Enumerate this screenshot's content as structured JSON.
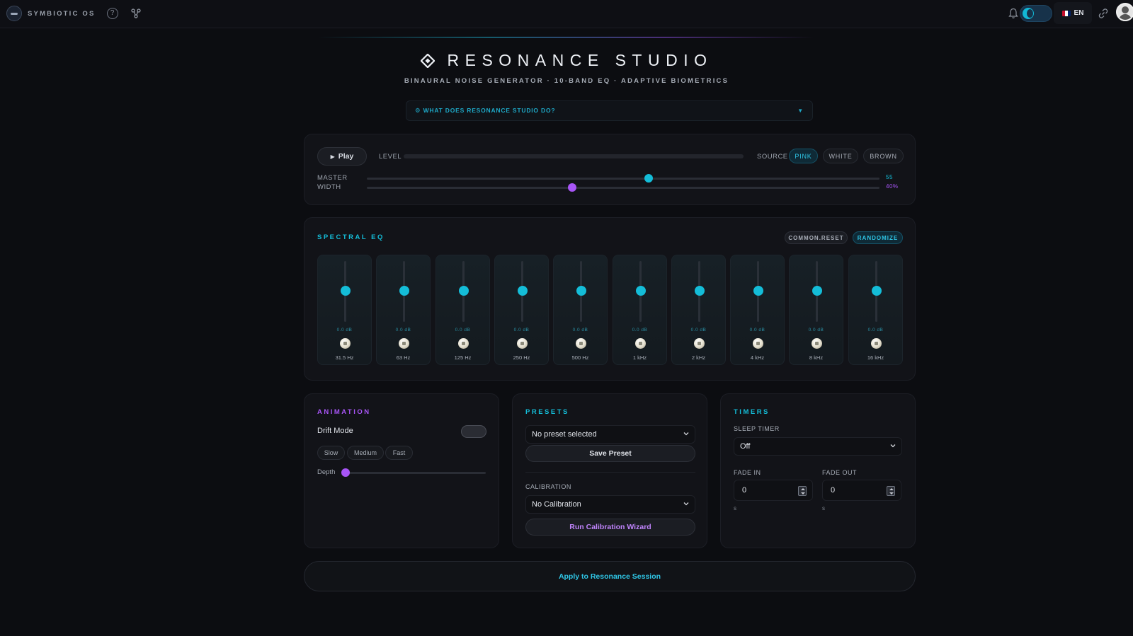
{
  "topbar": {
    "brand_name": "SYMBIOTIC OS",
    "help_label": "?",
    "language": "EN"
  },
  "header": {
    "title": "RESONANCE STUDIO",
    "subtitle": "BINAURAL NOISE GENERATOR · 10-BAND EQ · ADAPTIVE BIOMETRICS",
    "info_bar": "⚙ WHAT DOES RESONANCE STUDIO DO?",
    "info_arrow": "▼"
  },
  "transport": {
    "play_label": "Play",
    "play_icon": "▶",
    "level_label": "LEVEL",
    "source_label": "SOURCE",
    "sources": [
      "PINK",
      "WHITE",
      "BROWN"
    ],
    "selected_source": "PINK",
    "master_label": "MASTER",
    "master_value": "55",
    "master_level": 0.55,
    "width_label": "WIDTH",
    "width_value": "40%",
    "width_level": 0.4
  },
  "eq": {
    "title": "SPECTRAL EQ",
    "reset_label": "COMMON.RESET",
    "randomize_label": "RANDOMIZE",
    "bands": [
      {
        "freq": "31.5 Hz",
        "gain": "0.0 dB"
      },
      {
        "freq": "63 Hz",
        "gain": "0.0 dB"
      },
      {
        "freq": "125 Hz",
        "gain": "0.0 dB"
      },
      {
        "freq": "250 Hz",
        "gain": "0.0 dB"
      },
      {
        "freq": "500 Hz",
        "gain": "0.0 dB"
      },
      {
        "freq": "1 kHz",
        "gain": "0.0 dB"
      },
      {
        "freq": "2 kHz",
        "gain": "0.0 dB"
      },
      {
        "freq": "4 kHz",
        "gain": "0.0 dB"
      },
      {
        "freq": "8 kHz",
        "gain": "0.0 dB"
      },
      {
        "freq": "16 kHz",
        "gain": "0.0 dB"
      }
    ]
  },
  "animation": {
    "title": "ANIMATION",
    "drift_label": "Drift Mode",
    "speeds": [
      "Slow",
      "Medium",
      "Fast"
    ],
    "depth_label": "Depth",
    "depth_level": 0
  },
  "presets": {
    "title": "PRESETS",
    "preset_value": "No preset selected",
    "save_label": "Save Preset",
    "calibration_label": "CALIBRATION",
    "calibration_value": "No Calibration",
    "wizard_label": "Run Calibration Wizard"
  },
  "timers": {
    "title": "TIMERS",
    "sleep_label": "SLEEP TIMER",
    "sleep_value": "Off",
    "fade_in_label": "FADE IN",
    "fade_in_value": "0",
    "fade_in_unit": "s",
    "fade_out_label": "FADE OUT",
    "fade_out_value": "0",
    "fade_out_unit": "s"
  },
  "apply_label": "Apply to Resonance Session",
  "colors": {
    "accent_cyan": "#14bdd8",
    "accent_purple": "#a855f7",
    "background": "#0c0d11"
  }
}
